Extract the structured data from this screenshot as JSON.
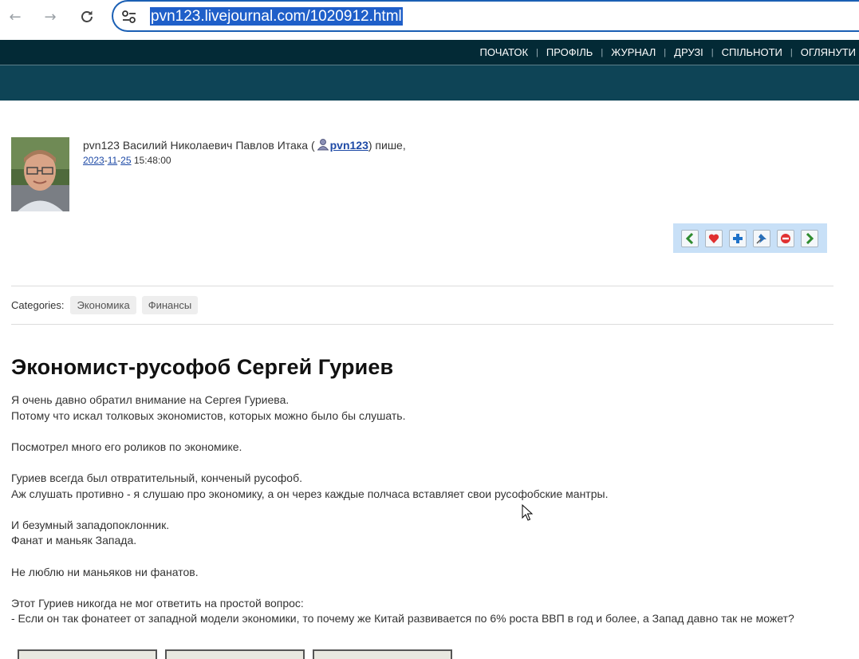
{
  "browser": {
    "url": "pvn123.livejournal.com/1020912.html",
    "back_icon": "arrow-left-icon",
    "forward_icon": "arrow-right-icon",
    "reload_icon": "reload-icon"
  },
  "topnav": {
    "items": [
      "ПОЧАТОК",
      "ПРОФІЛЬ",
      "ЖУРНАЛ",
      "ДРУЗІ",
      "СПІЛЬНОТИ",
      "ОГЛЯНУТИ"
    ]
  },
  "post": {
    "author_display": "pvn123 Василий Николаевич Павлов Итака (",
    "username": "pvn123",
    "writes": ") пише,",
    "date": {
      "year": "2023",
      "month": "11",
      "day": "25",
      "time": "15:48:00"
    },
    "categories_label": "Categories:",
    "categories": [
      "Экономика",
      "Финансы"
    ],
    "title": "Экономист-русофоб Сергей Гуриев",
    "paragraphs": [
      [
        "Я очень давно обратил внимание на Сергея Гуриева.",
        "Потому что искал толковых экономистов, которых можно было бы слушать."
      ],
      [
        "Посмотрел много его роликов по экономике."
      ],
      [
        "Гуриев всегда был отвратительный, конченый русофоб.",
        "Аж слушать противно - я слушаю про экономику, а он через каждые полчаса вставляет свои русофобские мантры."
      ],
      [
        "И безумный западопоклонник.",
        "Фанат и маньяк Запада."
      ],
      [
        "Не люблю ни маньяков ни фанатов."
      ],
      [
        "Этот Гуриев никогда не мог ответить на простой вопрос:",
        "- Если он так фонатеет от западной модели экономики, то почему же Китай развивается по 6% роста ВВП в год и более, а Запад давно так не может?"
      ]
    ]
  },
  "toolbar": {
    "icons": [
      "prev-entry-icon",
      "add-to-memories-icon",
      "add-tag-icon",
      "track-icon",
      "flag-icon",
      "next-entry-icon"
    ]
  },
  "colors": {
    "nav_dark": "#032a36",
    "nav_sub": "#0e4456",
    "link": "#1e4aa6",
    "toolbar_bg": "#c8e0f7"
  }
}
